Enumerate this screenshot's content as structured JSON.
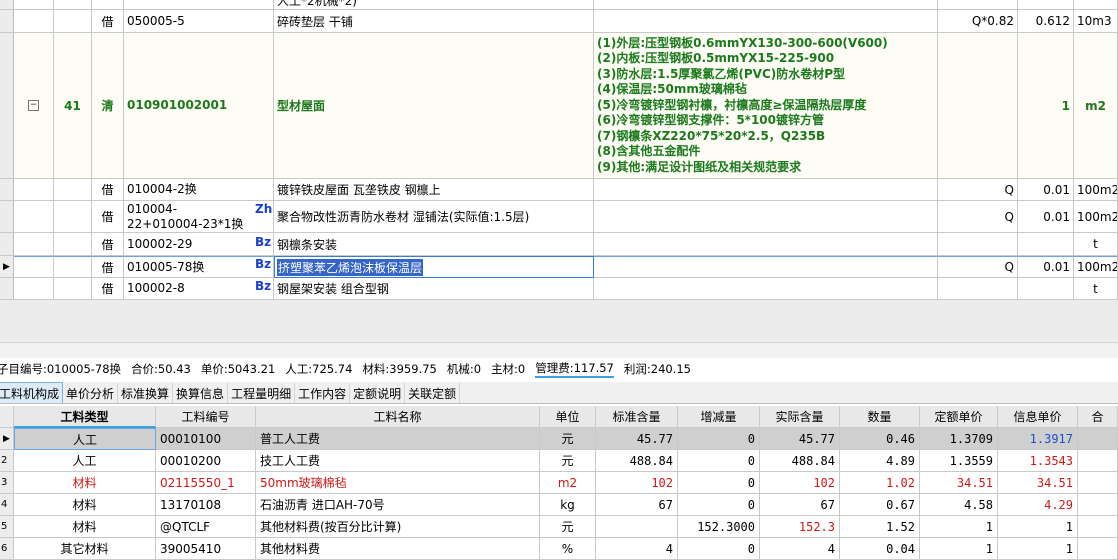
{
  "top_rows": [
    {
      "id": "partial",
      "type": "",
      "code": "",
      "name": "人工*2机械*2)",
      "desc": "",
      "qty_expr": "",
      "qty": "",
      "unit": ""
    },
    {
      "id": "r050005",
      "type": "借",
      "code": "050005-5",
      "name": "碎砖垫层 干铺",
      "desc": "",
      "qty_expr": "Q*0.82",
      "qty": "0.612",
      "unit": "10m3"
    },
    {
      "id": "r41",
      "index": "41",
      "type": "清",
      "code": "010901002001",
      "name": "型材屋面",
      "desc": "(1)外层:压型钢板0.6mmYX130-300-600(V600)\n(2)内板:压型钢板0.5mmYX15-225-900\n(3)防水层:1.5厚聚氯乙烯(PVC)防水卷材P型\n(4)保温层:50mm玻璃棉毡\n(5)冷弯镀锌型钢衬檩，衬檩高度≥保温隔热层厚度\n(6)冷弯镀锌型钢支撑件：5*100镀锌方管\n(7)钢檩条XZ220*75*20*2.5，Q235B\n(8)含其他五金配件\n(9)其他:满足设计图纸及相关规范要求",
      "qty_expr": "",
      "qty": "1",
      "unit": "m2"
    },
    {
      "id": "r010004-2",
      "type": "借",
      "code": "010004-2换",
      "name": "镀锌铁皮屋面 瓦垄铁皮 钢檩上",
      "desc": "",
      "qty_expr": "Q",
      "qty": "0.01",
      "unit": "100m2"
    },
    {
      "id": "r010004-22",
      "type": "借",
      "code": "010004-22+010004-23*1换",
      "badge": "Zh",
      "name": "聚合物改性沥青防水卷材 湿铺法(实际值:1.5层)",
      "desc": "",
      "qty_expr": "Q",
      "qty": "0.01",
      "unit": "100m2"
    },
    {
      "id": "r100002-29",
      "type": "借",
      "code": "100002-29",
      "badge": "Bz",
      "name": "钢檩条安装",
      "desc": "",
      "qty_expr": "",
      "qty": "",
      "unit": "t"
    },
    {
      "id": "r010005-78",
      "type": "借",
      "code": "010005-78换",
      "badge": "Bz",
      "name": "挤塑聚苯乙烯泡沫板保温层",
      "desc": "",
      "qty_expr": "Q",
      "qty": "0.01",
      "unit": "100m2"
    },
    {
      "id": "r100002-8",
      "type": "借",
      "code": "100002-8",
      "badge": "Bz",
      "name": "钢屋架安装 组合型钢",
      "desc": "",
      "qty_expr": "",
      "qty": "",
      "unit": "t"
    }
  ],
  "info_bar": {
    "code": "子目编号:010005-78换",
    "total": "合价:50.43",
    "unit_price": "单价:5043.21",
    "labor": "人工:725.74",
    "material": "材料:3959.75",
    "machine": "机械:0",
    "main_material": "主材:0",
    "management": "管理费:117.57",
    "profit": "利润:240.15"
  },
  "tabs": [
    "工料机构成",
    "单价分析",
    "标准换算",
    "换算信息",
    "工程量明细",
    "工作内容",
    "定额说明",
    "关联定额"
  ],
  "bottom_table": {
    "headers": [
      "工料类型",
      "工料编号",
      "工料名称",
      "单位",
      "标准含量",
      "增减量",
      "实际含量",
      "数量",
      "定额单价",
      "信息单价",
      "合"
    ],
    "rows": [
      {
        "n": "1",
        "type": "人工",
        "code": "00010100",
        "name": "普工人工费",
        "unit": "元",
        "std": "45.77",
        "delta": "0",
        "actual": "45.77",
        "count": "0.46",
        "quota": "1.3709",
        "info": "1.3917",
        "color": "normal",
        "info_color": "blue"
      },
      {
        "n": "2",
        "type": "人工",
        "code": "00010200",
        "name": "技工人工费",
        "unit": "元",
        "std": "488.84",
        "delta": "0",
        "actual": "488.84",
        "count": "4.89",
        "quota": "1.3559",
        "info": "1.3543",
        "color": "normal",
        "info_color": "red"
      },
      {
        "n": "3",
        "type": "材料",
        "code": "02115550_1",
        "name": "50mm玻璃棉毡",
        "unit": "m2",
        "std": "102",
        "delta": "0",
        "actual": "102",
        "count": "1.02",
        "quota": "34.51",
        "info": "34.51",
        "color": "red",
        "info_color": "red"
      },
      {
        "n": "4",
        "type": "材料",
        "code": "13170108",
        "name": "石油沥青 进口AH-70号",
        "unit": "kg",
        "std": "67",
        "delta": "0",
        "actual": "67",
        "count": "0.67",
        "quota": "4.58",
        "info": "4.29",
        "color": "normal",
        "info_color": "red"
      },
      {
        "n": "5",
        "type": "材料",
        "code": "@QTCLF",
        "name": "其他材料费(按百分比计算)",
        "unit": "元",
        "std": "",
        "delta": "152.3000",
        "actual": "152.3",
        "count": "1.52",
        "quota": "1",
        "info": "1",
        "color": "normal",
        "info_color": "normal",
        "actual_color": "red"
      },
      {
        "n": "6",
        "type": "其它材料",
        "code": "39005410",
        "name": "其他材料费",
        "unit": "%",
        "std": "4",
        "delta": "0",
        "actual": "4",
        "count": "0.04",
        "quota": "1",
        "info": "1",
        "color": "normal",
        "info_color": "normal"
      }
    ]
  }
}
